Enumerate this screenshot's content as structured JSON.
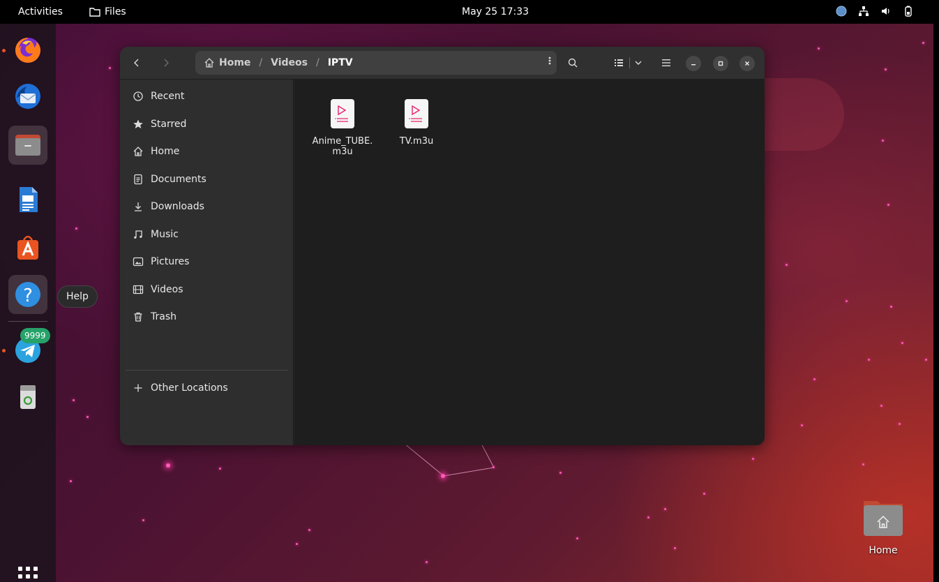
{
  "topbar": {
    "activities": "Activities",
    "app_name": "Files",
    "clock": "May 25  17:33"
  },
  "dock": {
    "tooltip": "Help",
    "telegram_badge": "9999",
    "items": [
      {
        "name": "firefox",
        "icon": "firefox-icon"
      },
      {
        "name": "thunderbird",
        "icon": "thunderbird-icon"
      },
      {
        "name": "files",
        "icon": "files-icon"
      },
      {
        "name": "libreoffice-writer",
        "icon": "writer-icon"
      },
      {
        "name": "app-center",
        "icon": "app-center-icon"
      },
      {
        "name": "help",
        "icon": "help-icon"
      },
      {
        "name": "telegram",
        "icon": "telegram-icon"
      },
      {
        "name": "trash",
        "icon": "trash-icon"
      }
    ]
  },
  "window": {
    "path": {
      "home": "Home",
      "sep": "/",
      "videos": "Videos",
      "current": "IPTV"
    },
    "sidebar": {
      "items": [
        {
          "label": "Recent",
          "icon": "clock-icon"
        },
        {
          "label": "Starred",
          "icon": "star-icon"
        },
        {
          "label": "Home",
          "icon": "home-icon"
        },
        {
          "label": "Documents",
          "icon": "document-icon"
        },
        {
          "label": "Downloads",
          "icon": "download-icon"
        },
        {
          "label": "Music",
          "icon": "music-icon"
        },
        {
          "label": "Pictures",
          "icon": "picture-icon"
        },
        {
          "label": "Videos",
          "icon": "video-icon"
        },
        {
          "label": "Trash",
          "icon": "trash-icon"
        }
      ],
      "other_locations": "Other Locations"
    },
    "files": [
      {
        "name": "Anime_TUBE.m3u",
        "icon": "playlist-icon"
      },
      {
        "name": "TV.m3u",
        "icon": "playlist-icon"
      }
    ]
  },
  "desktop": {
    "home_label": "Home"
  },
  "colors": {
    "accent": "#e95420",
    "playlist_icon": "#e6226e",
    "badge": "#26a269",
    "window_bg": "#242424"
  }
}
